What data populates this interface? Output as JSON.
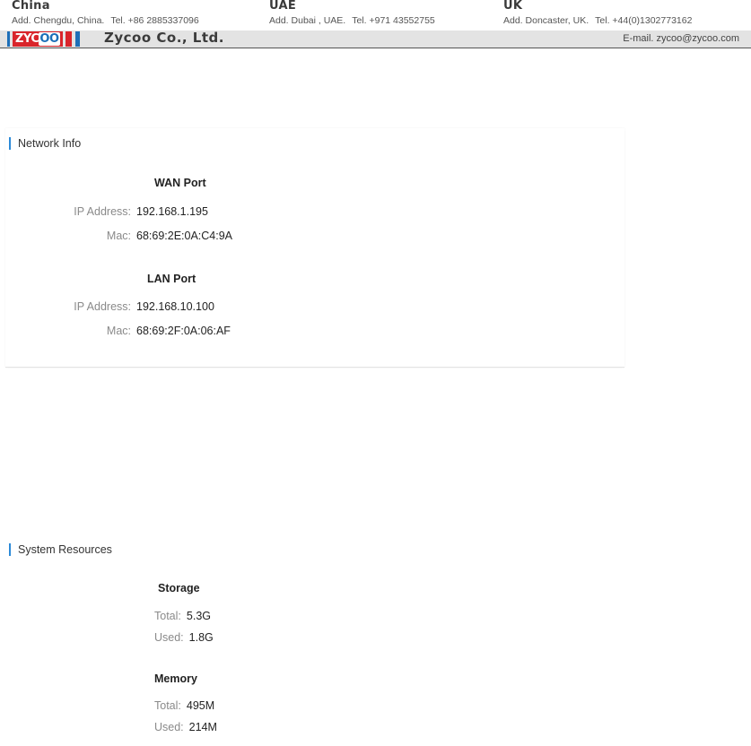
{
  "letterhead": {
    "offices": [
      {
        "country": "China",
        "address": "Add. Chengdu, China.",
        "tel": "Tel. +86 2885337096"
      },
      {
        "country": "UAE",
        "address": "Add. Dubai , UAE.",
        "tel": "Tel. +971 43552755"
      },
      {
        "country": "UK",
        "address": "Add. Doncaster, UK.",
        "tel": "Tel. +44(0)1302773162"
      }
    ],
    "logo_text_left": "ZYC",
    "logo_text_oo": "OO",
    "company": "Zycoo  Co., Ltd.",
    "email": "E-mail. zycoo@zycoo.com",
    "colors": {
      "brand_red": "#d9252b",
      "brand_blue": "#1d6fb8",
      "accent_blue": "#2c8ad8"
    }
  },
  "network_info": {
    "title": "Network Info",
    "wan": {
      "title": "WAN Port",
      "ip_label": "IP Address:",
      "ip": "192.168.1.195",
      "mac_label": "Mac:",
      "mac": "68:69:2E:0A:C4:9A"
    },
    "lan": {
      "title": "LAN Port",
      "ip_label": "IP Address:",
      "ip": "192.168.10.100",
      "mac_label": "Mac:",
      "mac": "68:69:2F:0A:06:AF"
    }
  },
  "system_resources": {
    "title": "System Resources",
    "storage": {
      "title": "Storage",
      "total_label": "Total:",
      "total": "5.3G",
      "used_label": "Used:",
      "used": "1.8G"
    },
    "memory": {
      "title": "Memory",
      "total_label": "Total:",
      "total": "495M",
      "used_label": "Used:",
      "used": "214M"
    }
  }
}
